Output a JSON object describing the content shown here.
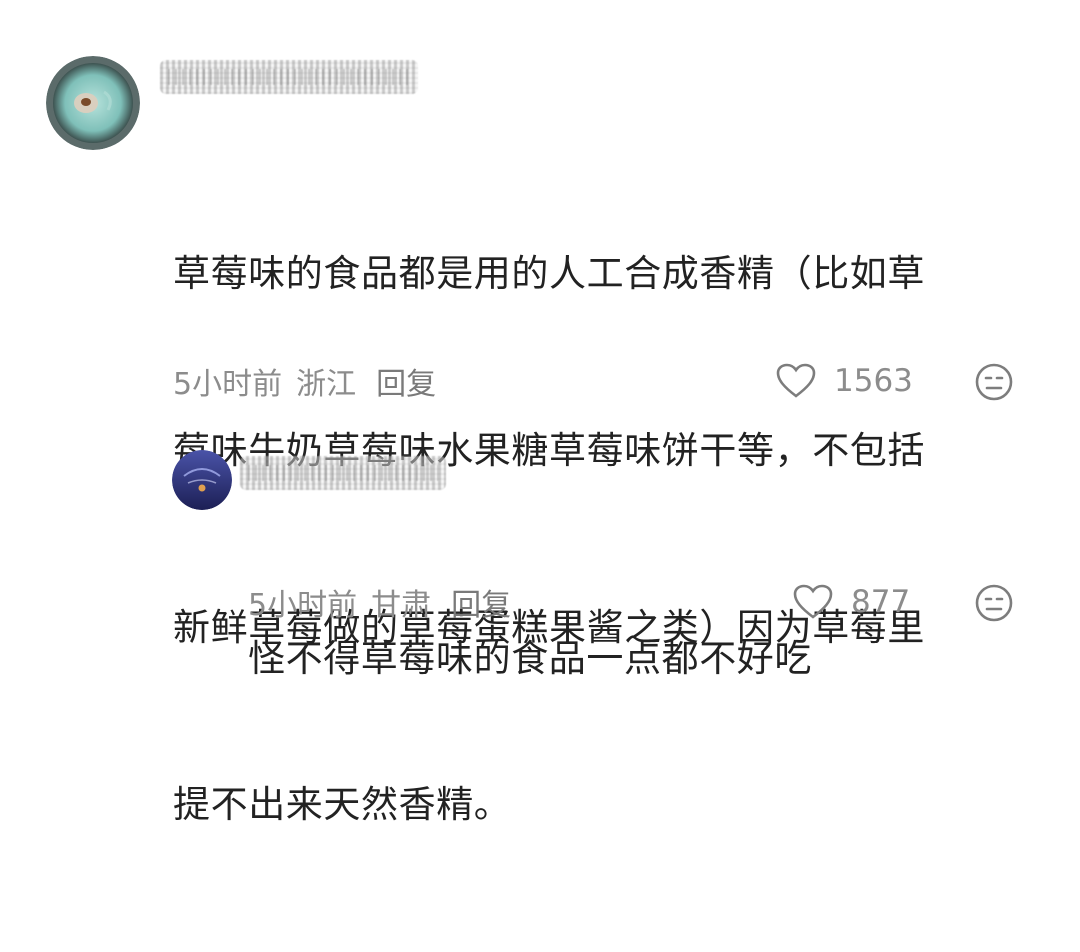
{
  "comments": [
    {
      "text": "草莓味的食品都是用的人工合成香精（比如草莓味牛奶草莓味水果糖草莓味饼干等，不包括新鲜草莓做的草莓蛋糕果酱之类）因为草莓里提不出来天然香精。",
      "lines": [
        "草莓味的食品都是用的人工合成香精（比如草",
        "莓味牛奶草莓味水果糖草莓味饼干等，不包括",
        "新鲜草莓做的草莓蛋糕果酱之类）因为草莓里",
        "提不出来天然香精。"
      ],
      "time": "5小时前",
      "location": "浙江",
      "reply_label": "回复",
      "likes": "1563",
      "icons": {
        "like": "heart-icon",
        "dislike": "meh-face-icon"
      }
    },
    {
      "text": "怪不得草莓味的食品一点都不好吃",
      "lines": [
        "怪不得草莓味的食品一点都不好吃"
      ],
      "time": "5小时前",
      "location": "甘肃",
      "reply_label": "回复",
      "likes": "877",
      "icons": {
        "like": "heart-icon",
        "dislike": "meh-face-icon"
      }
    }
  ],
  "colors": {
    "text": "#222222",
    "meta": "#8c8c8c",
    "avatar1": "#8fc9c4",
    "avatar2": "#2a2f7a"
  }
}
